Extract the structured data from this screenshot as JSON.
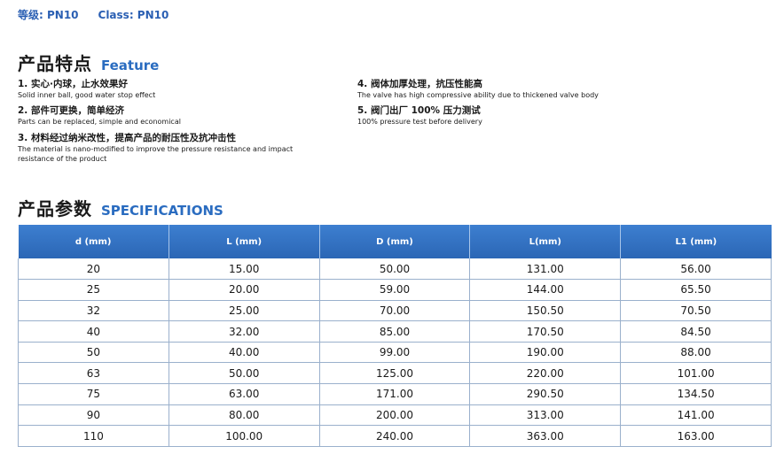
{
  "grade": {
    "cn": "等级: PN10",
    "en": "Class: PN10"
  },
  "features": {
    "title_cn": "产品特点",
    "title_en": "Feature",
    "items": [
      {
        "cn": "1. 实心·内球，止水效果好",
        "en": "Solid inner ball, good water stop effect"
      },
      {
        "cn": "2. 部件可更换，简单经济",
        "en": "Parts can be replaced, simple and economical"
      },
      {
        "cn": "3. 材料经过纳米改性，提高产品的耐压性及抗冲击性",
        "en": "The material is nano-modified to improve the pressure resistance and impact",
        "en2": "resistance of the product"
      },
      {
        "cn": "4. 阀体加厚处理，抗压性能高",
        "en": "The valve has high compressive ability due to thickened valve body"
      },
      {
        "cn": "5. 阀门出厂 100% 压力测试",
        "en": "100% pressure test before delivery"
      }
    ]
  },
  "specs": {
    "title_cn": "产品参数",
    "title_en": "SPECIFICATIONS",
    "headers": [
      "d (mm)",
      "L (mm)",
      "D (mm)",
      "L(mm)",
      "L1 (mm)"
    ],
    "rows": [
      [
        "20",
        "15.00",
        "50.00",
        "131.00",
        "56.00"
      ],
      [
        "25",
        "20.00",
        "59.00",
        "144.00",
        "65.50"
      ],
      [
        "32",
        "25.00",
        "70.00",
        "150.50",
        "70.50"
      ],
      [
        "40",
        "32.00",
        "85.00",
        "170.50",
        "84.50"
      ],
      [
        "50",
        "40.00",
        "99.00",
        "190.00",
        "88.00"
      ],
      [
        "63",
        "50.00",
        "125.00",
        "220.00",
        "101.00"
      ],
      [
        "75",
        "63.00",
        "171.00",
        "290.50",
        "134.50"
      ],
      [
        "90",
        "80.00",
        "200.00",
        "313.00",
        "141.00"
      ],
      [
        "110",
        "100.00",
        "240.00",
        "363.00",
        "163.00"
      ]
    ]
  },
  "colors": {
    "accent": "#2a6cc0",
    "header_bg": "#3372c4",
    "grid": "#9ab0cc"
  }
}
